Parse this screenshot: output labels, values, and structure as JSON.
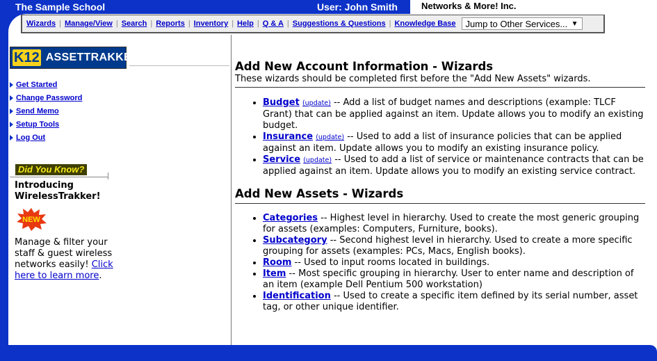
{
  "header": {
    "school": "The Sample School",
    "user": "User: John Smith",
    "vendor": "Networks & More! Inc."
  },
  "nav": {
    "items": [
      "Wizards",
      "Manage/View",
      "Search",
      "Reports",
      "Inventory",
      "Help",
      "Q & A",
      "Suggestions & Questions",
      "Knowledge Base"
    ],
    "jump_select": "Jump to Other Services..."
  },
  "sidebar": {
    "logo_k12": "K12",
    "logo_text": "ASSETTRAKKER",
    "links": [
      "Get Started",
      "Change Password",
      "Send Memo",
      "Setup Tools",
      "Log Out"
    ],
    "dyk_label": "Did You Know?",
    "intro_line1": "Introducing",
    "intro_line2": "WirelessTrakker!",
    "new_badge": "NEW",
    "promo_text": "Manage & filter your staff & guest wireless networks easily! ",
    "promo_link": "Click here to learn more",
    "promo_end": "."
  },
  "main": {
    "section1": {
      "title": "Add New Account Information - Wizards",
      "subtitle": "These wizards should be completed first before the \"Add New Assets\" wizards.",
      "items": [
        {
          "name": "Budget",
          "update": "(update)",
          "desc": " -- Add a list of budget names and descriptions (example: TLCF Grant) that can be applied against an item. Update allows you to modify an existing budget."
        },
        {
          "name": "Insurance",
          "update": "(update)",
          "desc": " -- Used to add a list of insurance policies that can be applied against an item. Update allows you to modify an existing insurance policy."
        },
        {
          "name": "Service",
          "update": "(update)",
          "desc": " -- Used to add a list of service or maintenance contracts that can be applied against an item. Update allows you to modify an existing service contract."
        }
      ]
    },
    "section2": {
      "title": "Add New Assets - Wizards",
      "items": [
        {
          "name": "Categories",
          "desc": " -- Highest level in hierarchy. Used to create the most generic grouping for assets (examples: Computers, Furniture, books)."
        },
        {
          "name": "Subcategory",
          "desc": " -- Second highest level in hierarchy. Used to create a more specific grouping for assets (examples: PCs, Macs, English books)."
        },
        {
          "name": "Room",
          "desc": " -- Used to input rooms located in buildings."
        },
        {
          "name": "Item",
          "desc": " -- Most specific grouping in hierarchy. User to enter name and description of an item (example Dell Pentium 500 workstation)"
        },
        {
          "name": "Identification",
          "desc": " -- Used to create a specific item defined by its serial number, asset tag, or other unique identifier."
        }
      ]
    }
  },
  "colors": {
    "frame_blue": "#0c32c8",
    "link_blue": "#0000cc",
    "dyk_yellow": "#f4e81a"
  }
}
